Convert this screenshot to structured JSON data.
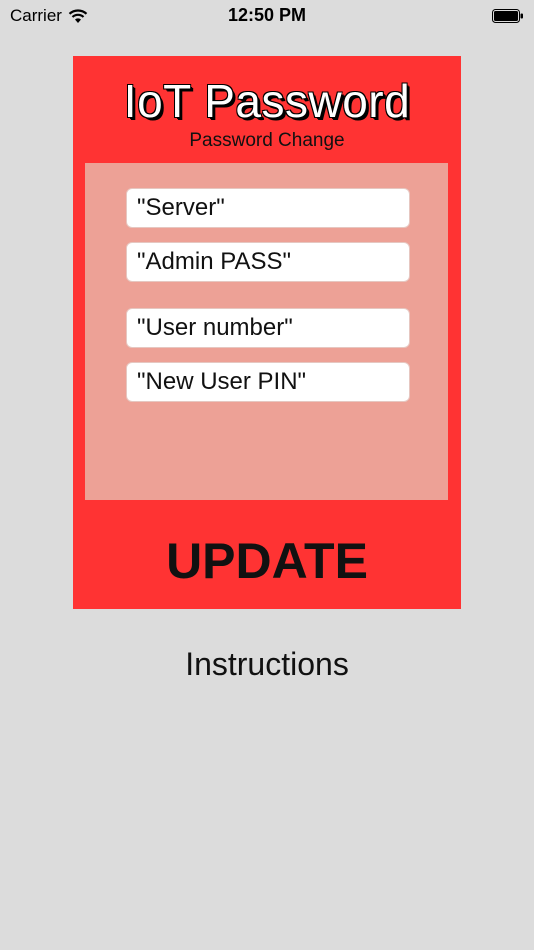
{
  "status_bar": {
    "carrier": "Carrier",
    "time": "12:50 PM",
    "wifi_icon": "wifi-icon",
    "battery_icon": "battery-full-icon"
  },
  "card": {
    "title": "IoT Password",
    "subtitle": "Password Change",
    "background_color": "#ff3333",
    "panel_color": "#eda196"
  },
  "form": {
    "server_placeholder": "\"Server\"",
    "admin_pass_placeholder": "\"Admin PASS\"",
    "user_number_placeholder": "\"User number\"",
    "new_user_pin_placeholder": "\"New User PIN\""
  },
  "actions": {
    "update_label": "UPDATE",
    "instructions_label": "Instructions"
  }
}
